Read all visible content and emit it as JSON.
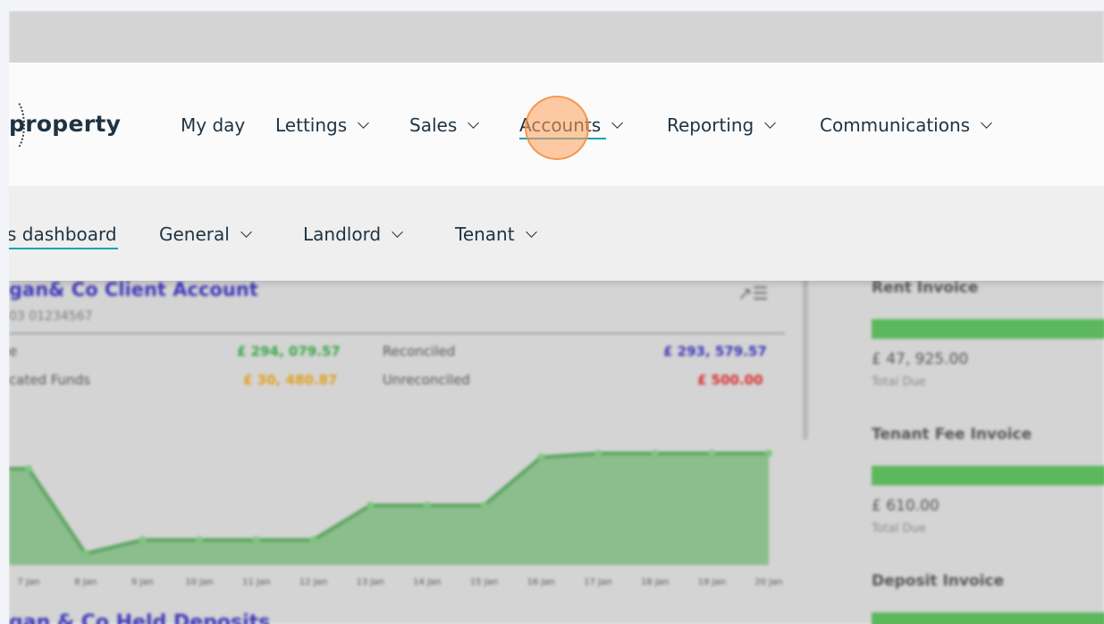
{
  "nav": {
    "logo_text": "property",
    "items": [
      {
        "label": "My day",
        "dropdown": false
      },
      {
        "label": "Lettings",
        "dropdown": true
      },
      {
        "label": "Sales",
        "dropdown": true
      },
      {
        "label": "Accounts",
        "dropdown": true,
        "active": true
      },
      {
        "label": "Reporting",
        "dropdown": true
      },
      {
        "label": "Communications",
        "dropdown": true
      }
    ]
  },
  "subnav": {
    "items": [
      {
        "label": "s dashboard",
        "active": true,
        "dropdown": false
      },
      {
        "label": "General",
        "dropdown": true
      },
      {
        "label": "Landlord",
        "dropdown": true
      },
      {
        "label": "Tenant",
        "dropdown": true
      }
    ]
  },
  "account": {
    "title": "gan& Co Client Account",
    "subtitle": "03  01234567",
    "balance_label": "e",
    "balance_value": "£ 294, 079.57",
    "reconciled_label": "Reconciled",
    "reconciled_value": "£ 293, 579.57",
    "allocated_label": "cated Funds",
    "allocated_value": "£ 30, 480.87",
    "unreconciled_label": "Unreconciled",
    "unreconciled_value": "£ 500.00",
    "colors": {
      "positive": "#3aa64a",
      "warning": "#e0a020",
      "negative": "#d83030",
      "link": "#3d37b8"
    }
  },
  "chart_data": {
    "type": "area",
    "x": [
      "7 Jan",
      "8 Jan",
      "9 Jan",
      "10 Jan",
      "11 Jan",
      "12 Jan",
      "13 Jan",
      "14 Jan",
      "15 Jan",
      "16 Jan",
      "17 Jan",
      "18 Jan",
      "19 Jan",
      "20 Jan"
    ],
    "ticks": [
      "7 Jan",
      "8 Jan",
      "9 Jan",
      "10 Jan",
      "11 Jan",
      "12 Jan",
      "13 Jan",
      "14 Jan",
      "15 Jan",
      "16 Jan",
      "17 Jan",
      "18 Jan",
      "19 Jan",
      "20 Jan"
    ],
    "values": [
      100,
      12,
      26,
      26,
      26,
      26,
      62,
      62,
      62,
      112,
      116,
      116,
      116,
      116
    ],
    "ylim": [
      0,
      130
    ],
    "color": "#5aa55e"
  },
  "next_section_title": "gan & Co Held Deposits",
  "invoices": [
    {
      "title": "Rent Invoice",
      "amount": "£ 47, 925.00",
      "caption": "Total Due"
    },
    {
      "title": "Tenant Fee Invoice",
      "amount": "£ 610.00",
      "caption": "Total Due"
    },
    {
      "title": "Deposit Invoice",
      "amount": "",
      "caption": ""
    }
  ]
}
